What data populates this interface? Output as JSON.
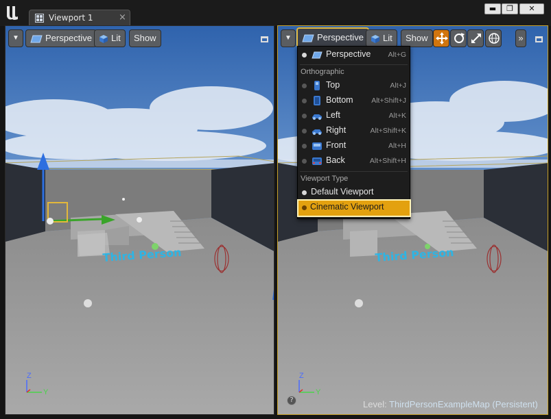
{
  "window": {
    "tab_label": "Viewport 1",
    "tab_close": "×",
    "minimize": "▬",
    "maximize": "❐",
    "close": "✕"
  },
  "left_viewport": {
    "toolbar": {
      "perspective": "Perspective",
      "lit": "Lit",
      "show": "Show"
    },
    "axis": {
      "z": "Z",
      "y": "Y"
    }
  },
  "right_viewport": {
    "toolbar": {
      "perspective": "Perspective",
      "lit": "Lit",
      "show": "Show",
      "more": "»"
    },
    "axis": {
      "z": "Z",
      "y": "Y"
    },
    "level_label": "Level:",
    "level_name": "ThirdPersonExampleMap (Persistent)",
    "help_icon_glyph": "?"
  },
  "scene_text": "Third Person",
  "menu": {
    "perspective": {
      "label": "Perspective",
      "shortcut": "Alt+G"
    },
    "section_ortho": "Orthographic",
    "ortho_items": [
      {
        "label": "Top",
        "shortcut": "Alt+J",
        "icon": "camera-top-icon"
      },
      {
        "label": "Bottom",
        "shortcut": "Alt+Shift+J",
        "icon": "camera-bottom-icon"
      },
      {
        "label": "Left",
        "shortcut": "Alt+K",
        "icon": "camera-left-icon"
      },
      {
        "label": "Right",
        "shortcut": "Alt+Shift+K",
        "icon": "camera-right-icon"
      },
      {
        "label": "Front",
        "shortcut": "Alt+H",
        "icon": "camera-front-icon"
      },
      {
        "label": "Back",
        "shortcut": "Alt+Shift+H",
        "icon": "camera-back-icon"
      }
    ],
    "section_type": "Viewport Type",
    "default_viewport": "Default Viewport",
    "cinematic_viewport": "Cinematic Viewport"
  },
  "colors": {
    "accent": "#e3a10f",
    "highlight_border": "#e3b83a",
    "orange_button": "#d1750e"
  }
}
